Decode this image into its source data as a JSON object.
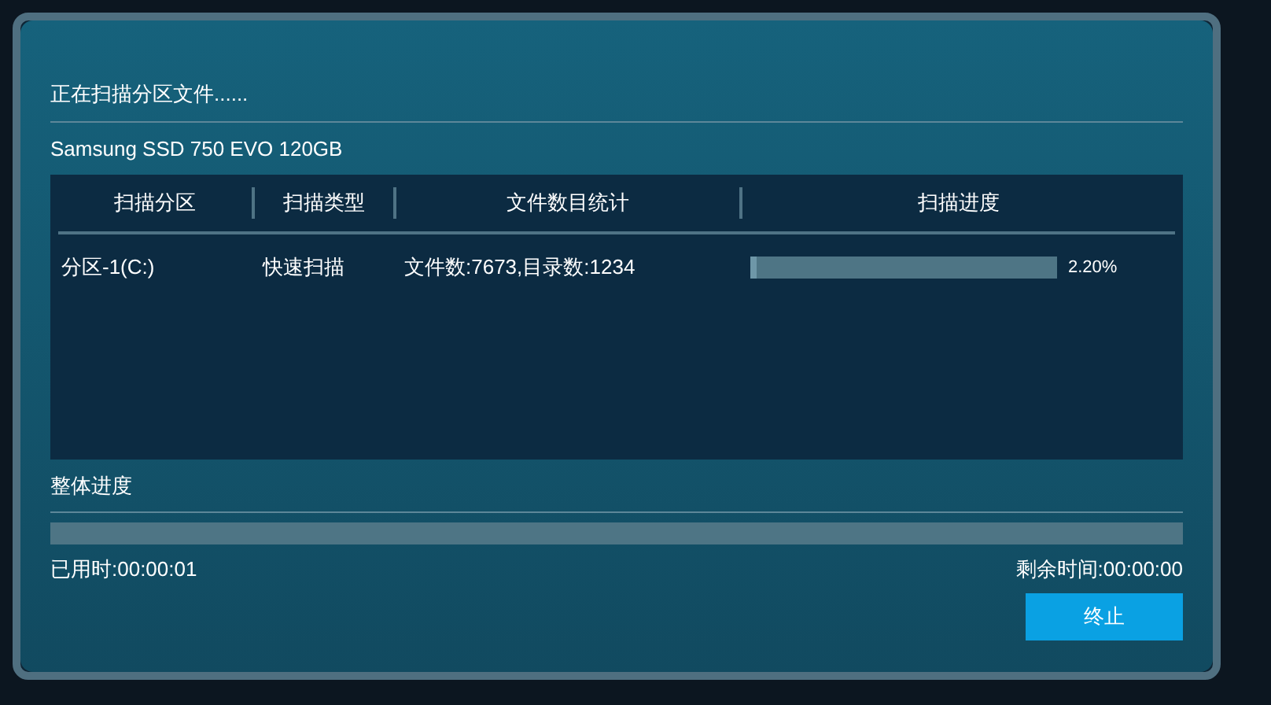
{
  "dialog": {
    "status": "正在扫描分区文件......",
    "device": "Samsung SSD 750 EVO 120GB"
  },
  "table": {
    "columns": [
      "扫描分区",
      "扫描类型",
      "文件数目统计",
      "扫描进度"
    ],
    "rows": [
      {
        "partition": "分区-1(C:)",
        "scan_type": "快速扫描",
        "stats": "文件数:7673,目录数:1234",
        "level": 0.022,
        "percent": "2.20%"
      }
    ]
  },
  "overall": {
    "label": "整体进度",
    "elapsed": "已用时:00:00:01",
    "remaining": "剩余时间:00:00:00"
  },
  "buttons": [
    {
      "label": "终止"
    }
  ]
}
